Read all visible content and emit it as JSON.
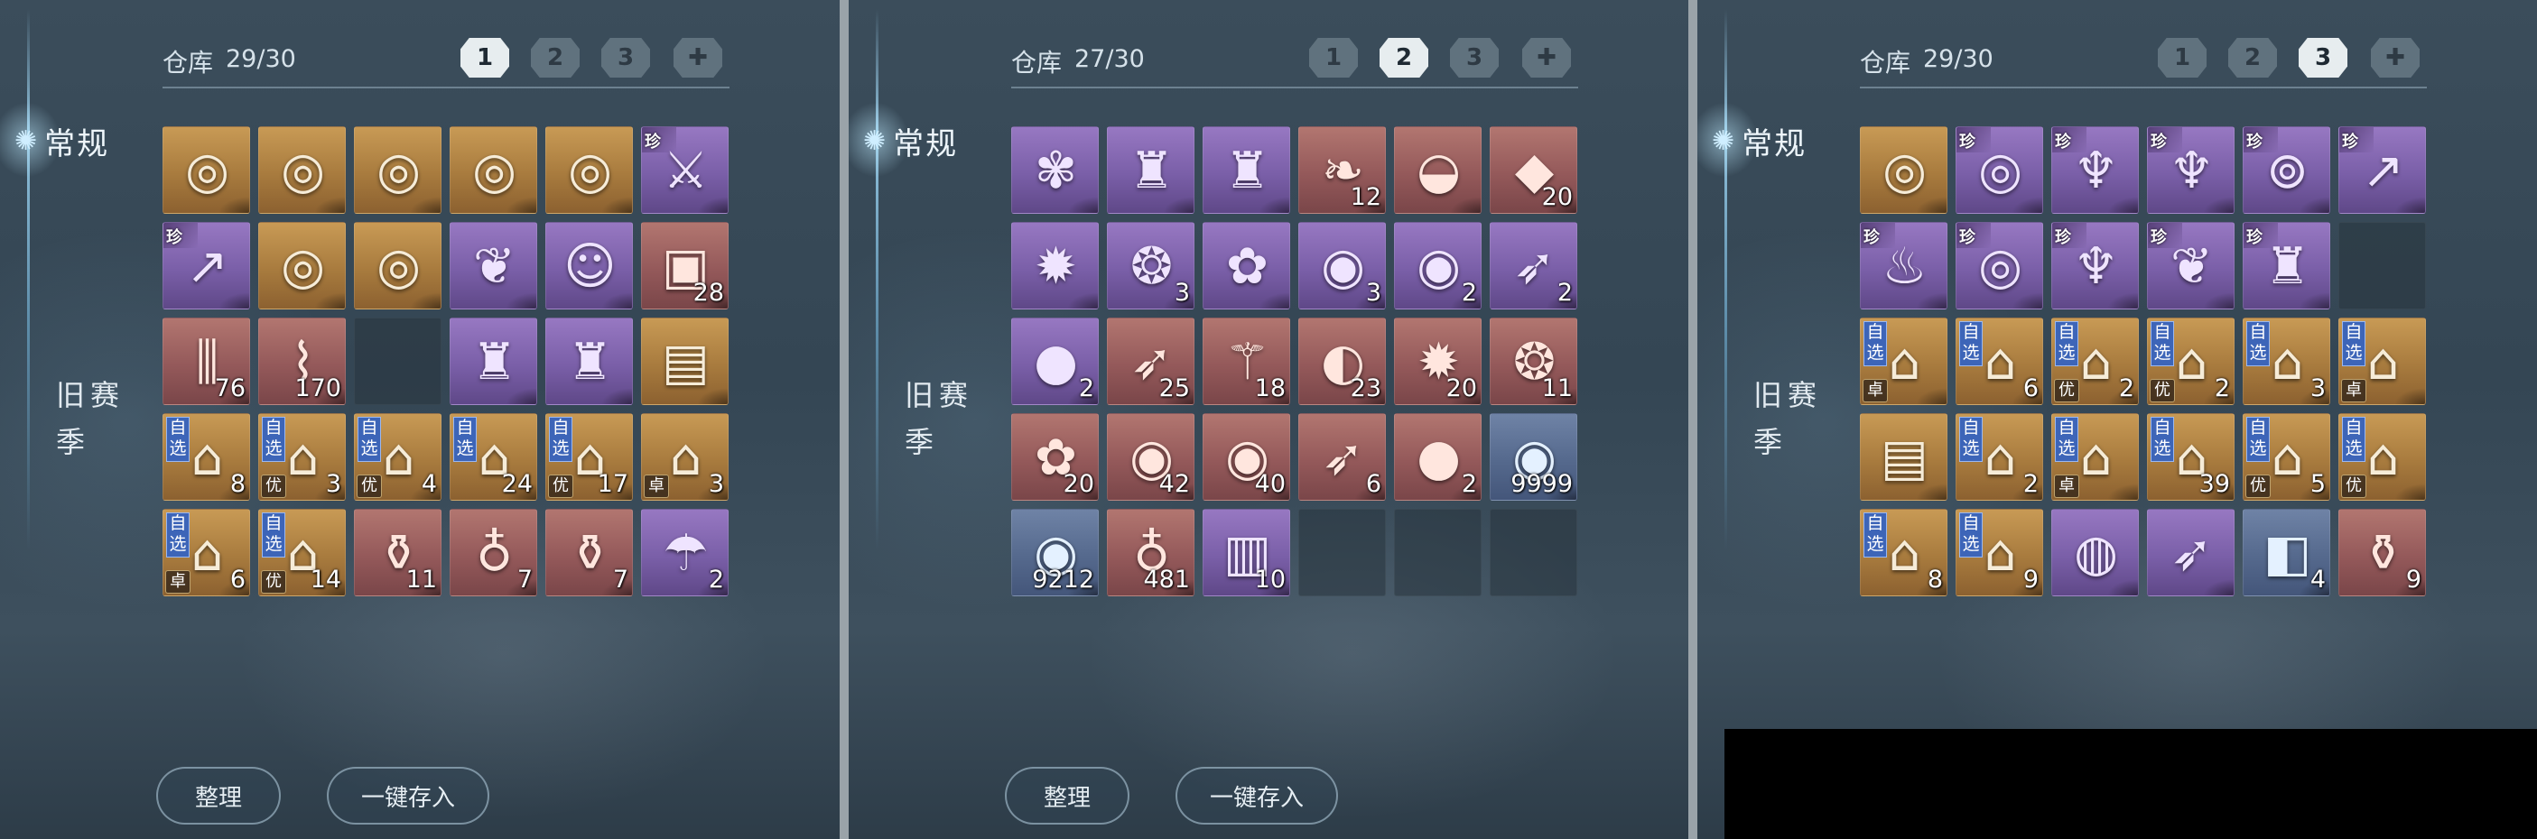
{
  "icons": {
    "category": "swirl-icon",
    "page": "chest-icon",
    "add_page": "plus-icon"
  },
  "colors": {
    "gold": "#b7884a",
    "purple": "#7d62ab",
    "red": "#955b5b",
    "blue": "#566a8e",
    "select_badge": "#3d65b8"
  },
  "panels": [
    {
      "title": "仓库",
      "count": "29/30",
      "pages": [
        "1",
        "2",
        "3"
      ],
      "active_page": 0,
      "categories": [
        "常规",
        "旧赛季"
      ],
      "buttons": {
        "sort": "整理",
        "store_all": "一键存入"
      },
      "items": [
        {
          "rarity": "gold",
          "icon": "ring-icon",
          "qty": "",
          "tag": "",
          "select": "",
          "grade": ""
        },
        {
          "rarity": "gold",
          "icon": "ring-icon",
          "qty": "",
          "tag": "",
          "select": "",
          "grade": ""
        },
        {
          "rarity": "gold",
          "icon": "ring-icon",
          "qty": "",
          "tag": "",
          "select": "",
          "grade": ""
        },
        {
          "rarity": "gold",
          "icon": "ring-icon",
          "qty": "",
          "tag": "",
          "select": "",
          "grade": ""
        },
        {
          "rarity": "gold",
          "icon": "ring-icon",
          "qty": "",
          "tag": "",
          "select": "",
          "grade": ""
        },
        {
          "rarity": "purple",
          "icon": "sword-icon",
          "qty": "",
          "tag": "珍",
          "select": "",
          "grade": ""
        },
        {
          "rarity": "purple",
          "icon": "spear-icon",
          "qty": "",
          "tag": "珍",
          "select": "",
          "grade": ""
        },
        {
          "rarity": "gold",
          "icon": "ring-icon",
          "qty": "",
          "tag": "",
          "select": "",
          "grade": ""
        },
        {
          "rarity": "gold",
          "icon": "ring-icon",
          "qty": "",
          "tag": "",
          "select": "",
          "grade": ""
        },
        {
          "rarity": "purple",
          "icon": "pouch-icon",
          "qty": "",
          "tag": "",
          "select": "",
          "grade": ""
        },
        {
          "rarity": "purple",
          "icon": "cat-mask-icon",
          "qty": "",
          "tag": "",
          "select": "",
          "grade": ""
        },
        {
          "rarity": "red",
          "icon": "gift-box-icon",
          "qty": "28",
          "tag": "",
          "select": "",
          "grade": ""
        },
        {
          "rarity": "red",
          "icon": "firecracker-icon",
          "qty": "76",
          "tag": "",
          "select": "",
          "grade": ""
        },
        {
          "rarity": "red",
          "icon": "scroll-icon",
          "qty": "170",
          "tag": "",
          "select": "",
          "grade": ""
        },
        {
          "rarity": "empty",
          "icon": "",
          "qty": "",
          "tag": "",
          "select": "",
          "grade": ""
        },
        {
          "rarity": "purple",
          "icon": "armor-icon",
          "qty": "",
          "tag": "",
          "select": "",
          "grade": ""
        },
        {
          "rarity": "purple",
          "icon": "armor-icon",
          "qty": "",
          "tag": "",
          "select": "",
          "grade": ""
        },
        {
          "rarity": "gold",
          "icon": "box-icon",
          "qty": "",
          "tag": "",
          "select": "",
          "grade": ""
        },
        {
          "rarity": "gold",
          "icon": "chest-icon",
          "qty": "8",
          "tag": "",
          "select": "自选",
          "grade": ""
        },
        {
          "rarity": "gold",
          "icon": "chest-icon",
          "qty": "3",
          "tag": "",
          "select": "自选",
          "grade": "优"
        },
        {
          "rarity": "gold",
          "icon": "chest-icon",
          "qty": "4",
          "tag": "",
          "select": "自选",
          "grade": "优"
        },
        {
          "rarity": "gold",
          "icon": "chest-icon",
          "qty": "24",
          "tag": "",
          "select": "自选",
          "grade": ""
        },
        {
          "rarity": "gold",
          "icon": "chest-icon",
          "qty": "17",
          "tag": "",
          "select": "自选",
          "grade": "优"
        },
        {
          "rarity": "gold",
          "icon": "chest-icon",
          "qty": "3",
          "tag": "",
          "select": "",
          "grade": "卓"
        },
        {
          "rarity": "gold",
          "icon": "chest-icon",
          "qty": "6",
          "tag": "",
          "select": "自选",
          "grade": "卓"
        },
        {
          "rarity": "gold",
          "icon": "chest-icon",
          "qty": "14",
          "tag": "",
          "select": "自选",
          "grade": "优"
        },
        {
          "rarity": "red",
          "icon": "vase-icon",
          "qty": "11",
          "tag": "",
          "select": "",
          "grade": ""
        },
        {
          "rarity": "red",
          "icon": "gourd-icon",
          "qty": "7",
          "tag": "",
          "select": "",
          "grade": ""
        },
        {
          "rarity": "red",
          "icon": "vase-icon",
          "qty": "7",
          "tag": "",
          "select": "",
          "grade": ""
        },
        {
          "rarity": "purple",
          "icon": "umbrella-icon",
          "qty": "2",
          "tag": "",
          "select": "",
          "grade": ""
        }
      ]
    },
    {
      "title": "仓库",
      "count": "27/30",
      "pages": [
        "1",
        "2",
        "3"
      ],
      "active_page": 1,
      "categories": [
        "常规",
        "旧赛季"
      ],
      "buttons": {
        "sort": "整理",
        "store_all": "一键存入"
      },
      "items": [
        {
          "rarity": "purple",
          "icon": "butterfly-icon",
          "qty": "",
          "tag": "",
          "select": "",
          "grade": ""
        },
        {
          "rarity": "purple",
          "icon": "armor-icon",
          "qty": "",
          "tag": "",
          "select": "",
          "grade": ""
        },
        {
          "rarity": "purple",
          "icon": "armor-icon",
          "qty": "",
          "tag": "",
          "select": "",
          "grade": ""
        },
        {
          "rarity": "red",
          "icon": "bag-icon",
          "qty": "12",
          "tag": "",
          "select": "",
          "grade": ""
        },
        {
          "rarity": "red",
          "icon": "bowl-icon",
          "qty": "",
          "tag": "",
          "select": "",
          "grade": ""
        },
        {
          "rarity": "red",
          "icon": "ore-icon",
          "qty": "20",
          "tag": "",
          "select": "",
          "grade": ""
        },
        {
          "rarity": "purple",
          "icon": "medallion-icon",
          "qty": "",
          "tag": "",
          "select": "",
          "grade": ""
        },
        {
          "rarity": "purple",
          "icon": "pendant-icon",
          "qty": "3",
          "tag": "",
          "select": "",
          "grade": ""
        },
        {
          "rarity": "purple",
          "icon": "flower-icon",
          "qty": "",
          "tag": "",
          "select": "",
          "grade": ""
        },
        {
          "rarity": "purple",
          "icon": "eye-icon",
          "qty": "3",
          "tag": "",
          "select": "",
          "grade": ""
        },
        {
          "rarity": "purple",
          "icon": "eye-icon",
          "qty": "2",
          "tag": "",
          "select": "",
          "grade": ""
        },
        {
          "rarity": "purple",
          "icon": "feather-icon",
          "qty": "2",
          "tag": "",
          "select": "",
          "grade": ""
        },
        {
          "rarity": "purple",
          "icon": "pearl-icon",
          "qty": "2",
          "tag": "",
          "select": "",
          "grade": ""
        },
        {
          "rarity": "red",
          "icon": "feather-icon",
          "qty": "25",
          "tag": "",
          "select": "",
          "grade": ""
        },
        {
          "rarity": "red",
          "icon": "branch-icon",
          "qty": "18",
          "tag": "",
          "select": "",
          "grade": ""
        },
        {
          "rarity": "red",
          "icon": "fan-icon",
          "qty": "23",
          "tag": "",
          "select": "",
          "grade": ""
        },
        {
          "rarity": "red",
          "icon": "medallion-icon",
          "qty": "20",
          "tag": "",
          "select": "",
          "grade": ""
        },
        {
          "rarity": "red",
          "icon": "pendant-icon",
          "qty": "11",
          "tag": "",
          "select": "",
          "grade": ""
        },
        {
          "rarity": "red",
          "icon": "flower-icon",
          "qty": "20",
          "tag": "",
          "select": "",
          "grade": ""
        },
        {
          "rarity": "red",
          "icon": "eye-icon",
          "qty": "42",
          "tag": "",
          "select": "",
          "grade": ""
        },
        {
          "rarity": "red",
          "icon": "eye-icon",
          "qty": "40",
          "tag": "",
          "select": "",
          "grade": ""
        },
        {
          "rarity": "red",
          "icon": "feather-icon",
          "qty": "6",
          "tag": "",
          "select": "",
          "grade": ""
        },
        {
          "rarity": "red",
          "icon": "pearl-icon",
          "qty": "2",
          "tag": "",
          "select": "",
          "grade": ""
        },
        {
          "rarity": "blue",
          "icon": "eye-icon",
          "qty": "9999",
          "tag": "",
          "select": "",
          "grade": ""
        },
        {
          "rarity": "blue",
          "icon": "eye-icon",
          "qty": "9212",
          "tag": "",
          "select": "",
          "grade": ""
        },
        {
          "rarity": "red",
          "icon": "gourd-icon",
          "qty": "481",
          "tag": "",
          "select": "",
          "grade": ""
        },
        {
          "rarity": "purple",
          "icon": "book-icon",
          "qty": "10",
          "tag": "",
          "select": "",
          "grade": ""
        },
        {
          "rarity": "empty",
          "icon": "",
          "qty": "",
          "tag": "",
          "select": "",
          "grade": ""
        },
        {
          "rarity": "empty",
          "icon": "",
          "qty": "",
          "tag": "",
          "select": "",
          "grade": ""
        },
        {
          "rarity": "empty",
          "icon": "",
          "qty": "",
          "tag": "",
          "select": "",
          "grade": ""
        }
      ]
    },
    {
      "title": "仓库",
      "count": "29/30",
      "pages": [
        "1",
        "2",
        "3"
      ],
      "active_page": 2,
      "categories": [
        "常规",
        "旧赛季"
      ],
      "buttons": {
        "sort": "",
        "store_all": ""
      },
      "items": [
        {
          "rarity": "gold",
          "icon": "ring-icon",
          "qty": "",
          "tag": "",
          "select": "",
          "grade": ""
        },
        {
          "rarity": "purple",
          "icon": "ring-icon",
          "qty": "",
          "tag": "珍",
          "select": "",
          "grade": ""
        },
        {
          "rarity": "purple",
          "icon": "necklace-icon",
          "qty": "",
          "tag": "珍",
          "select": "",
          "grade": ""
        },
        {
          "rarity": "purple",
          "icon": "necklace-icon",
          "qty": "",
          "tag": "珍",
          "select": "",
          "grade": ""
        },
        {
          "rarity": "purple",
          "icon": "bracelet-icon",
          "qty": "",
          "tag": "珍",
          "select": "",
          "grade": ""
        },
        {
          "rarity": "purple",
          "icon": "spear-icon",
          "qty": "",
          "tag": "珍",
          "select": "",
          "grade": ""
        },
        {
          "rarity": "purple",
          "icon": "cauldron-icon",
          "qty": "",
          "tag": "珍",
          "select": "",
          "grade": ""
        },
        {
          "rarity": "purple",
          "icon": "ring-icon",
          "qty": "",
          "tag": "珍",
          "select": "",
          "grade": ""
        },
        {
          "rarity": "purple",
          "icon": "necklace-icon",
          "qty": "",
          "tag": "珍",
          "select": "",
          "grade": ""
        },
        {
          "rarity": "purple",
          "icon": "pouch-icon",
          "qty": "",
          "tag": "珍",
          "select": "",
          "grade": ""
        },
        {
          "rarity": "purple",
          "icon": "armor-icon",
          "qty": "",
          "tag": "珍",
          "select": "",
          "grade": ""
        },
        {
          "rarity": "empty",
          "icon": "",
          "qty": "",
          "tag": "",
          "select": "",
          "grade": ""
        },
        {
          "rarity": "gold",
          "icon": "chest-icon",
          "qty": "",
          "tag": "",
          "select": "自选",
          "grade": "卓"
        },
        {
          "rarity": "gold",
          "icon": "chest-icon",
          "qty": "6",
          "tag": "",
          "select": "自选",
          "grade": ""
        },
        {
          "rarity": "gold",
          "icon": "chest-icon",
          "qty": "2",
          "tag": "",
          "select": "自选",
          "grade": "优"
        },
        {
          "rarity": "gold",
          "icon": "chest-icon",
          "qty": "2",
          "tag": "",
          "select": "自选",
          "grade": "优"
        },
        {
          "rarity": "gold",
          "icon": "chest-icon",
          "qty": "3",
          "tag": "",
          "select": "自选",
          "grade": ""
        },
        {
          "rarity": "gold",
          "icon": "chest-icon",
          "qty": "",
          "tag": "",
          "select": "自选",
          "grade": "卓"
        },
        {
          "rarity": "gold",
          "icon": "box-icon",
          "qty": "",
          "tag": "",
          "select": "",
          "grade": ""
        },
        {
          "rarity": "gold",
          "icon": "chest-icon",
          "qty": "2",
          "tag": "",
          "select": "自选",
          "grade": ""
        },
        {
          "rarity": "gold",
          "icon": "chest-icon",
          "qty": "",
          "tag": "",
          "select": "自选",
          "grade": "卓"
        },
        {
          "rarity": "gold",
          "icon": "chest-icon",
          "qty": "39",
          "tag": "",
          "select": "自选",
          "grade": ""
        },
        {
          "rarity": "gold",
          "icon": "chest-icon",
          "qty": "5",
          "tag": "",
          "select": "自选",
          "grade": "优"
        },
        {
          "rarity": "gold",
          "icon": "chest-icon",
          "qty": "",
          "tag": "",
          "select": "自选",
          "grade": "优"
        },
        {
          "rarity": "gold",
          "icon": "chest-icon",
          "qty": "8",
          "tag": "",
          "select": "自选",
          "grade": ""
        },
        {
          "rarity": "gold",
          "icon": "chest-icon",
          "qty": "9",
          "tag": "",
          "select": "自选",
          "grade": ""
        },
        {
          "rarity": "purple",
          "icon": "crystal-ball-icon",
          "qty": "",
          "tag": "",
          "select": "",
          "grade": ""
        },
        {
          "rarity": "purple",
          "icon": "feather-icon",
          "qty": "",
          "tag": "",
          "select": "",
          "grade": ""
        },
        {
          "rarity": "blue",
          "icon": "jade-box-icon",
          "qty": "4",
          "tag": "",
          "select": "",
          "grade": ""
        },
        {
          "rarity": "red",
          "icon": "vase-icon",
          "qty": "9",
          "tag": "",
          "select": "",
          "grade": ""
        }
      ]
    }
  ]
}
